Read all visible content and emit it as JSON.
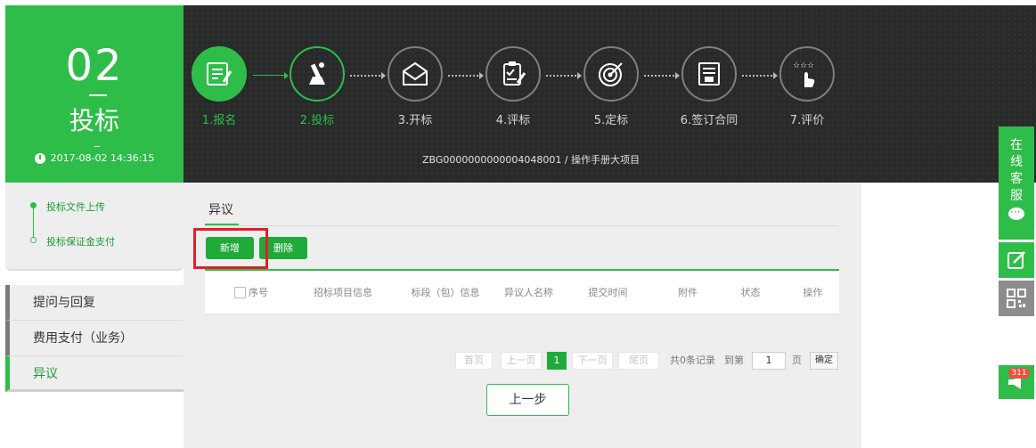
{
  "stage": {
    "number": "02",
    "name": "投标",
    "time": "2017-08-02 14:36:15"
  },
  "steps": [
    {
      "label": "1.报名",
      "icon": "registration-form-icon",
      "state": "done"
    },
    {
      "label": "2.投标",
      "icon": "bidding-hand-icon",
      "state": "active"
    },
    {
      "label": "3.开标",
      "icon": "open-envelope-icon",
      "state": "todo"
    },
    {
      "label": "4.评标",
      "icon": "evaluation-clipboard-icon",
      "state": "todo"
    },
    {
      "label": "5.定标",
      "icon": "target-icon",
      "state": "todo"
    },
    {
      "label": "6.签订合同",
      "icon": "contract-sign-icon",
      "state": "todo"
    },
    {
      "label": "7.评价",
      "icon": "rating-stars-icon",
      "state": "todo"
    }
  ],
  "project_line": "ZBG0000000000004048001 / 操作手册大项目",
  "progress": {
    "items": [
      "投标文件上传",
      "投标保证金支付"
    ]
  },
  "menu": {
    "items": [
      {
        "label": "提问与回复"
      },
      {
        "label": "费用支付（业务）"
      },
      {
        "label": "异议"
      }
    ]
  },
  "main": {
    "tab": "异议",
    "add_label": "新增",
    "delete_label": "删除",
    "columns": [
      "序号",
      "招标项目信息",
      "标段（包）信息",
      "异议人名称",
      "提交时间",
      "附件",
      "状态",
      "操作"
    ]
  },
  "pager": {
    "first": "首页",
    "prev": "上一页",
    "current": "1",
    "next": "下一页",
    "last": "尾页",
    "summary": "共0条记录",
    "goto_label": "到第",
    "goto_value": "1",
    "page_unit": "页",
    "confirm": "确定"
  },
  "prev_step_label": "上一步",
  "widgets": {
    "chat_chars": [
      "在",
      "线",
      "客",
      "服"
    ],
    "badge_count": "311"
  },
  "colors": {
    "accent": "#2fbd4a",
    "dark_band": "#282b2a",
    "highlight_box": "#e0202a"
  }
}
